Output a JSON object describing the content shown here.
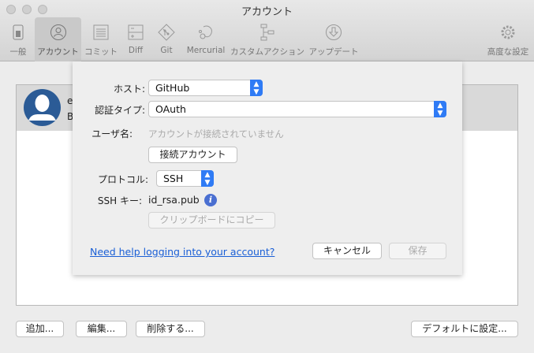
{
  "window": {
    "title": "アカウント"
  },
  "toolbar": {
    "items": [
      {
        "label": "一般",
        "icon": "switch-icon"
      },
      {
        "label": "アカウント",
        "icon": "user-icon"
      },
      {
        "label": "コミット",
        "icon": "document-icon"
      },
      {
        "label": "Diff",
        "icon": "diff-icon"
      },
      {
        "label": "Git",
        "icon": "git-icon"
      },
      {
        "label": "Mercurial",
        "icon": "mercurial-icon"
      },
      {
        "label": "カスタムアクション",
        "icon": "flow-icon"
      },
      {
        "label": "アップデート",
        "icon": "download-icon"
      }
    ],
    "advanced": {
      "label": "高度な設定",
      "icon": "gear-icon"
    }
  },
  "accounts": [
    {
      "line1": "e",
      "line2": "B"
    }
  ],
  "sheet": {
    "host_label": "ホスト:",
    "host_value": "GitHub",
    "auth_label": "認証タイプ:",
    "auth_value": "OAuth",
    "user_label": "ユーザ名:",
    "user_placeholder": "アカウントが接続されていません",
    "connect_button": "接続アカウント",
    "protocol_label": "プロトコル:",
    "protocol_value": "SSH",
    "sshkey_label": "SSH キー:",
    "sshkey_value": "id_rsa.pub",
    "copy_button": "クリップボードにコピー",
    "help_link": "Need help logging into your account?",
    "cancel_button": "キャンセル",
    "save_button": "保存"
  },
  "bottom": {
    "add": "追加...",
    "edit": "編集...",
    "delete": "削除する...",
    "default": "デフォルトに設定..."
  }
}
